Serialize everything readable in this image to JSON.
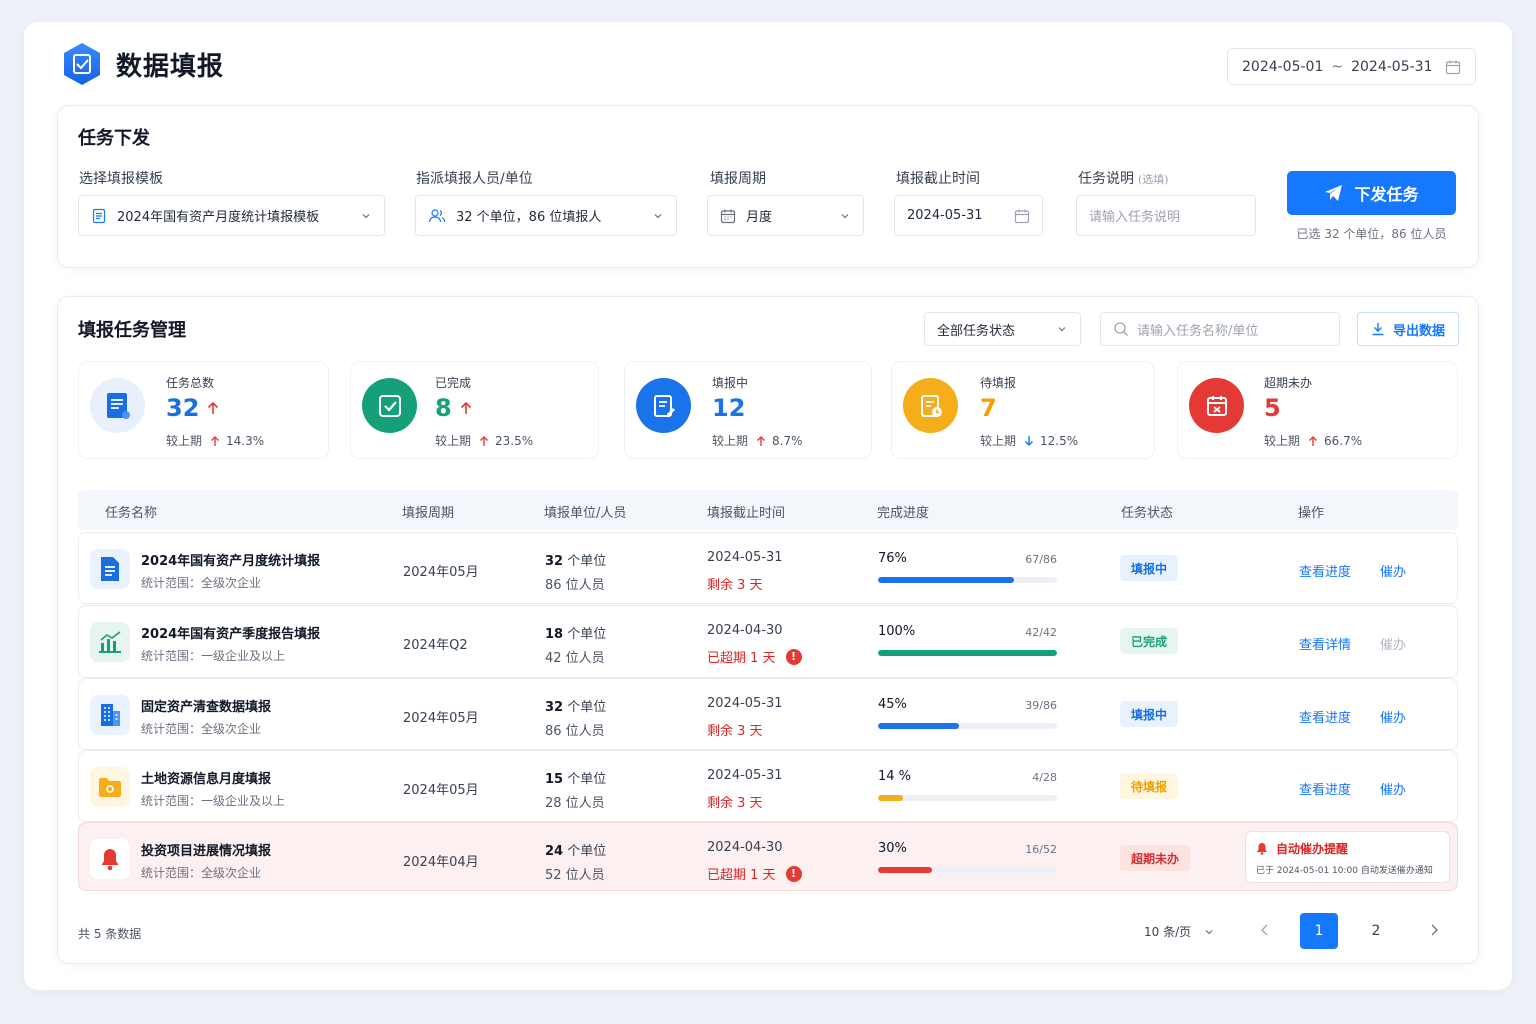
{
  "app": {
    "title": "数据填报"
  },
  "date_range": {
    "start": "2024-05-01",
    "separator": "~",
    "end": "2024-05-31"
  },
  "dispatch": {
    "title": "任务下发",
    "template": {
      "label": "选择填报模板",
      "value": "2024年国有资产月度统计填报模板"
    },
    "assignee": {
      "label": "指派填报人员/单位",
      "value": "32 个单位，86 位填报人"
    },
    "period": {
      "label": "填报周期",
      "value": "月度"
    },
    "deadline": {
      "label": "填报截止时间",
      "value": "2024-05-31"
    },
    "description": {
      "label": "任务说明",
      "optional": "(选填)",
      "placeholder": "请输入任务说明"
    },
    "submit_label": "下发任务",
    "selected_note": "已选 32 个单位，86 位人员"
  },
  "manage": {
    "title": "填报任务管理",
    "status_filter": "全部任务状态",
    "search_placeholder": "请输入任务名称/单位",
    "export_label": "导出数据",
    "stats": [
      {
        "label": "任务总数",
        "value": "32",
        "trend": "up",
        "compare_label": "较上期",
        "compare_value": "14.3%",
        "compare_trend": "up"
      },
      {
        "label": "已完成",
        "value": "8",
        "trend": "up",
        "compare_label": "较上期",
        "compare_value": "23.5%",
        "compare_trend": "up"
      },
      {
        "label": "填报中",
        "value": "12",
        "trend": "none",
        "compare_label": "较上期",
        "compare_value": "8.7%",
        "compare_trend": "up"
      },
      {
        "label": "待填报",
        "value": "7",
        "trend": "none",
        "compare_label": "较上期",
        "compare_value": "12.5%",
        "compare_trend": "down"
      },
      {
        "label": "超期未办",
        "value": "5",
        "trend": "none",
        "compare_label": "较上期",
        "compare_value": "66.7%",
        "compare_trend": "up"
      }
    ],
    "columns": [
      "任务名称",
      "填报周期",
      "填报单位/人员",
      "填报截止时间",
      "完成进度",
      "任务状态",
      "操作"
    ],
    "rows": [
      {
        "icon": "document-icon",
        "name": "2024年国有资产月度统计填报",
        "scope": "统计范围：全级次企业",
        "period": "2024年05月",
        "units": "32",
        "units_suffix": "个单位",
        "people": "86 位人员",
        "deadline": "2024-05-31",
        "remain": "剩余 3 天",
        "overdue": false,
        "percent_label": "76%",
        "progress": 0.76,
        "fraction": "67/86",
        "status": "填报中",
        "action1": "查看进度",
        "action2": "催办",
        "action2_disabled": false
      },
      {
        "icon": "chart-icon",
        "name": "2024年国有资产季度报告填报",
        "scope": "统计范围：一级企业及以上",
        "period": "2024年Q2",
        "units": "18",
        "units_suffix": "个单位",
        "people": "42 位人员",
        "deadline": "2024-04-30",
        "remain": "已超期 1 天",
        "overdue": true,
        "percent_label": "100%",
        "progress": 1.0,
        "fraction": "42/42",
        "status": "已完成",
        "action1": "查看详情",
        "action2": "催办",
        "action2_disabled": true
      },
      {
        "icon": "building-icon",
        "name": "固定资产清查数据填报",
        "scope": "统计范围：全级次企业",
        "period": "2024年05月",
        "units": "32",
        "units_suffix": "个单位",
        "people": "86 位人员",
        "deadline": "2024-05-31",
        "remain": "剩余 3 天",
        "overdue": false,
        "percent_label": "45%",
        "progress": 0.45,
        "fraction": "39/86",
        "status": "填报中",
        "action1": "查看进度",
        "action2": "催办",
        "action2_disabled": false
      },
      {
        "icon": "folder-icon",
        "name": "土地资源信息月度填报",
        "scope": "统计范围：一级企业及以上",
        "period": "2024年05月",
        "units": "15",
        "units_suffix": "个单位",
        "people": "28 位人员",
        "deadline": "2024-05-31",
        "remain": "剩余 3 天",
        "overdue": false,
        "percent_label": "14 %",
        "progress": 0.14,
        "fraction": "4/28",
        "status": "待填报",
        "action1": "查看进度",
        "action2": "催办",
        "action2_disabled": false
      },
      {
        "icon": "bell-icon",
        "name": "投资项目进展情况填报",
        "scope": "统计范围：全级次企业",
        "period": "2024年04月",
        "units": "24",
        "units_suffix": "个单位",
        "people": "52 位人员",
        "deadline": "2024-04-30",
        "remain": "已超期 1 天",
        "overdue": true,
        "percent_label": "30%",
        "progress": 0.3,
        "fraction": "16/52",
        "status": "超期未办",
        "auto_remind": {
          "title": "自动催办提醒",
          "text": "已于 2024-05-01 10:00 自动发送催办通知"
        }
      }
    ],
    "footer": {
      "total": "共 5 条数据",
      "page_size": "10 条/页",
      "pages": [
        "1",
        "2"
      ],
      "current_page": "1"
    }
  },
  "colors": {
    "primary": "#1677ff",
    "in_progress": "#1a73e8",
    "completed": "#16a07a",
    "pending": "#f6ad1b",
    "overdue": "#e53935"
  }
}
